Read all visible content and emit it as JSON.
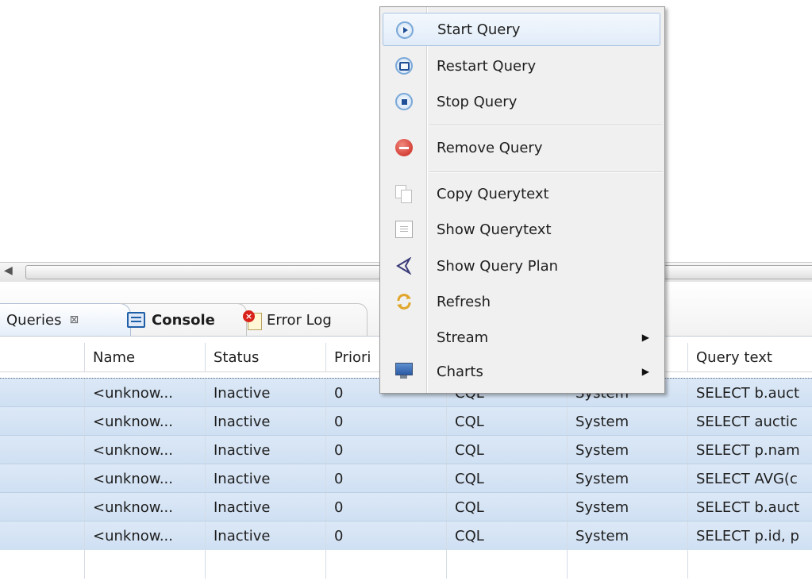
{
  "tabs": [
    {
      "label": "Queries",
      "close": "⊠"
    },
    {
      "label": "Console"
    },
    {
      "label": "Error Log"
    }
  ],
  "table": {
    "columns": [
      "",
      "Name",
      "Status",
      "Priori",
      "",
      "",
      "Query text"
    ],
    "rows": [
      {
        "name": "<unknow...",
        "status": "Inactive",
        "priority": "0",
        "parser": "CQL",
        "user": "System",
        "query": "SELECT b.auct"
      },
      {
        "name": "<unknow...",
        "status": "Inactive",
        "priority": "0",
        "parser": "CQL",
        "user": "System",
        "query": "SELECT auctic"
      },
      {
        "name": "<unknow...",
        "status": "Inactive",
        "priority": "0",
        "parser": "CQL",
        "user": "System",
        "query": "SELECT p.nam"
      },
      {
        "name": "<unknow...",
        "status": "Inactive",
        "priority": "0",
        "parser": "CQL",
        "user": "System",
        "query": "SELECT AVG(c"
      },
      {
        "name": "<unknow...",
        "status": "Inactive",
        "priority": "0",
        "parser": "CQL",
        "user": "System",
        "query": "SELECT b.auct"
      },
      {
        "name": "<unknow...",
        "status": "Inactive",
        "priority": "0",
        "parser": "CQL",
        "user": "System",
        "query": "SELECT p.id, p"
      }
    ]
  },
  "context_menu": {
    "items": [
      {
        "label": "Start Query",
        "icon": "start-icon",
        "highlighted": true
      },
      {
        "label": "Restart Query",
        "icon": "restart-icon"
      },
      {
        "label": "Stop Query",
        "icon": "stop-icon"
      },
      {
        "label": "Remove Query",
        "icon": "remove-icon"
      },
      {
        "label": "Copy Querytext",
        "icon": "copy-icon"
      },
      {
        "label": "Show Querytext",
        "icon": "document-icon"
      },
      {
        "label": "Show Query Plan",
        "icon": "query-plan-icon"
      },
      {
        "label": "Refresh",
        "icon": "refresh-icon"
      },
      {
        "label": "Stream",
        "submenu": true
      },
      {
        "label": "Charts",
        "icon": "monitor-icon",
        "submenu": true
      }
    ]
  },
  "colors": {
    "selection_row": "#d5e4f5",
    "menu_background": "#f0f0f0",
    "highlight_border": "#a9c3e2",
    "remove_red": "#d8221a"
  }
}
